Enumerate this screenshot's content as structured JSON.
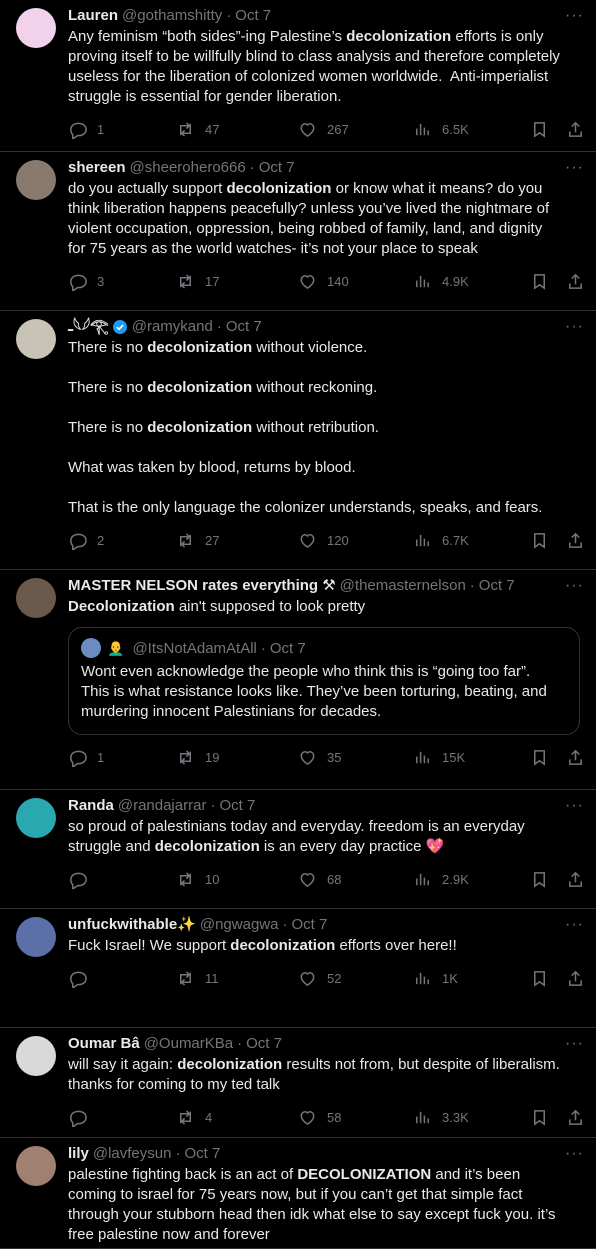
{
  "tweets": [
    {
      "name": "Lauren",
      "handle": "@gothamshitty",
      "date": "Oct 7",
      "text": [
        {
          "t": "Any feminism “both sides”-ing Palestine’s "
        },
        {
          "t": "decolonization",
          "b": true
        },
        {
          "t": " efforts is only\nproving itself to be willfully blind to class analysis and therefore completely\nuseless for the liberation of colonized women worldwide.  Anti-imperialist\nstruggle is essential for gender liberation."
        }
      ],
      "replies": "1",
      "retweets": "47",
      "likes": "267",
      "views": "6.5K",
      "avatar_color": "#f1d2ea"
    },
    {
      "name": "shereen",
      "handle": "@sheerohero666",
      "date": "Oct 7",
      "text": [
        {
          "t": "do you actually support "
        },
        {
          "t": "decolonization",
          "b": true
        },
        {
          "t": " or know what it means? do you\nthink liberation happens peacefully? unless you’ve lived the nightmare of\nviolent occupation, oppression, being robbed of family, land, and dignity\nfor 75 years as the world watches- it’s not your place to speak"
        }
      ],
      "replies": "3",
      "retweets": "17",
      "likes": "140",
      "views": "4.9K",
      "avatar_color": "#8a7a6e"
    },
    {
      "name": "ـ𓆩𓆪𓂀",
      "handle": "@ramykand",
      "date": "Oct 7",
      "verified": true,
      "text": [
        {
          "t": "There is no "
        },
        {
          "t": "decolonization",
          "b": true
        },
        {
          "t": " without violence.\n\nThere is no "
        },
        {
          "t": "decolonization",
          "b": true
        },
        {
          "t": " without reckoning.\n\nThere is no "
        },
        {
          "t": "decolonization",
          "b": true
        },
        {
          "t": " without retribution.\n\nWhat was taken by blood, returns by blood.\n\nThat is the only language the colonizer understands, speaks, and fears."
        }
      ],
      "replies": "2",
      "retweets": "27",
      "likes": "120",
      "views": "6.7K",
      "avatar_color": "#c9c2b6"
    },
    {
      "name": "MASTER NELSON rates everything ⚒",
      "handle": "@themasternelson",
      "date": "Oct 7",
      "text": [
        {
          "t": "Decolonization",
          "b": true
        },
        {
          "t": " ain't supposed to look pretty"
        }
      ],
      "quote": {
        "emoji": "👨‍🦲",
        "handle": "@ItsNotAdamAtAll",
        "date": "Oct 7",
        "text": "Wont even acknowledge the people who think this is “going too far”.\nThis is what resistance looks like. They’ve been torturing, beating, and\nmurdering innocent Palestinians for decades."
      },
      "replies": "1",
      "retweets": "19",
      "likes": "35",
      "views": "15K",
      "avatar_color": "#6b5a4c"
    },
    {
      "name": "Randa",
      "handle": "@randajarrar",
      "date": "Oct 7",
      "text": [
        {
          "t": "so proud of palestinians today and everyday. freedom is an everyday\nstruggle and "
        },
        {
          "t": "decolonization",
          "b": true
        },
        {
          "t": " is an every day practice 💖"
        }
      ],
      "replies": "",
      "retweets": "10",
      "likes": "68",
      "views": "2.9K",
      "avatar_color": "#2aa8b0"
    },
    {
      "name": "unfuckwithable✨",
      "handle": "@ngwagwa",
      "date": "Oct 7",
      "text": [
        {
          "t": "Fuck Israel! We support "
        },
        {
          "t": "decolonization",
          "b": true
        },
        {
          "t": " efforts over here!!"
        }
      ],
      "replies": "",
      "retweets": "11",
      "likes": "52",
      "views": "1K",
      "avatar_color": "#5b6fa8"
    },
    {
      "name": "Oumar Bâ",
      "handle": "@OumarKBa",
      "date": "Oct 7",
      "text": [
        {
          "t": "will say it again: "
        },
        {
          "t": "decolonization",
          "b": true
        },
        {
          "t": " results not from, but despite of liberalism.\nthanks for coming to my ted talk"
        }
      ],
      "replies": "",
      "retweets": "4",
      "likes": "58",
      "views": "3.3K",
      "avatar_color": "#d9d9d9"
    },
    {
      "name": "lily",
      "handle": "@lavfeysun",
      "date": "Oct 7",
      "text": [
        {
          "t": "palestine fighting back is an act of "
        },
        {
          "t": "DECOLONIZATION",
          "b": true
        },
        {
          "t": " and it’s been\ncoming to israel for 75 years now, but if you can’t get that simple fact\nthrough your stubborn head then idk what else to say except fuck you. it’s\nfree palestine now and forever"
        }
      ],
      "avatar_color": "#a08070"
    }
  ]
}
